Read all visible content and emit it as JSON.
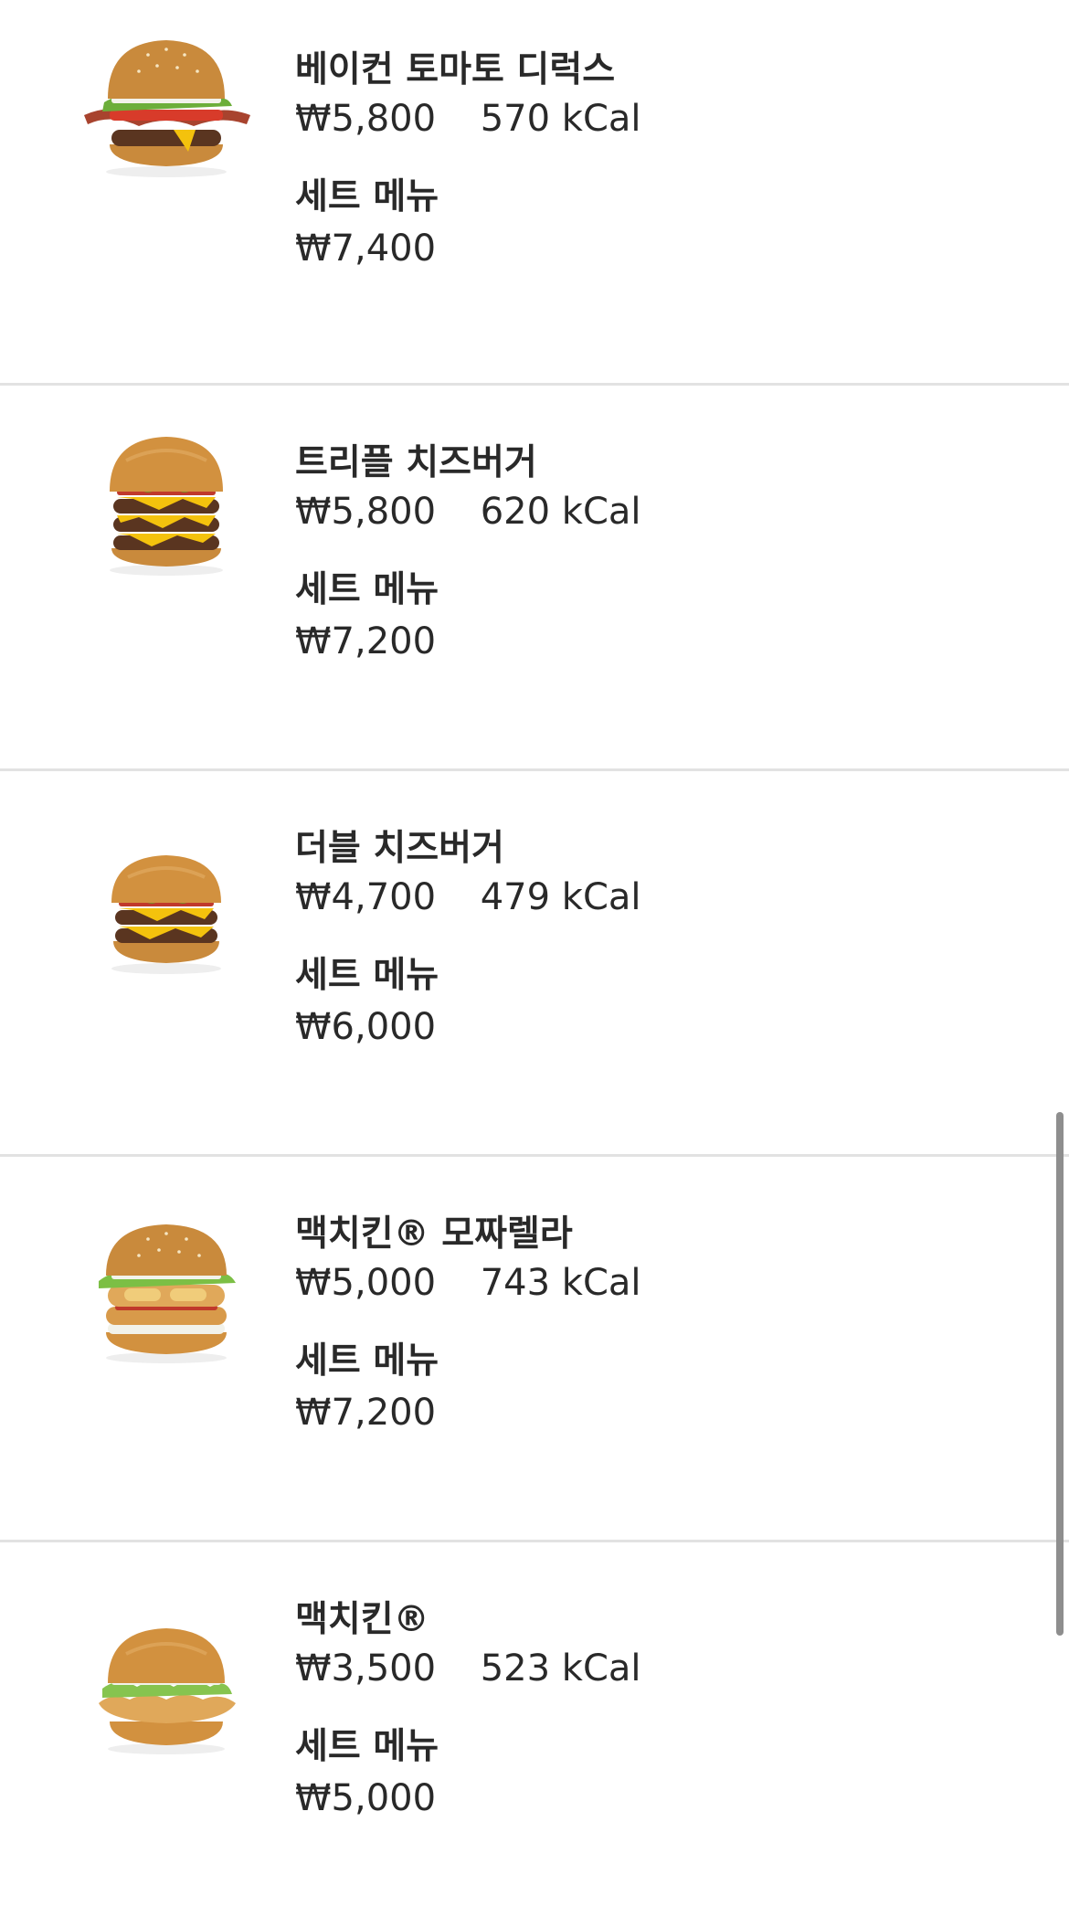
{
  "items": [
    {
      "name": "베이컨 토마토 디럭스",
      "price": "₩5,800",
      "kcal": "570 kCal",
      "set_label": "세트 메뉴",
      "set_price": "₩7,400",
      "image": "bacon-tomato-deluxe-burger"
    },
    {
      "name": "트리플 치즈버거",
      "price": "₩5,800",
      "kcal": "620 kCal",
      "set_label": "세트 메뉴",
      "set_price": "₩7,200",
      "image": "triple-cheeseburger"
    },
    {
      "name": "더블 치즈버거",
      "price": "₩4,700",
      "kcal": "479 kCal",
      "set_label": "세트 메뉴",
      "set_price": "₩6,000",
      "image": "double-cheeseburger"
    },
    {
      "name": "맥치킨® 모짜렐라",
      "price": "₩5,000",
      "kcal": "743 kCal",
      "set_label": "세트 메뉴",
      "set_price": "₩7,200",
      "image": "mcchicken-mozzarella-burger"
    },
    {
      "name": "맥치킨®",
      "price": "₩3,500",
      "kcal": "523 kCal",
      "set_label": "세트 메뉴",
      "set_price": "₩5,000",
      "image": "mcchicken-burger"
    }
  ],
  "colors": {
    "text": "#292929",
    "divider": "#e2e2e2",
    "scrollbar": "#8e8e8e"
  }
}
